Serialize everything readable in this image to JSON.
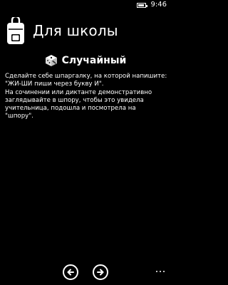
{
  "status": {
    "time": "9:46",
    "icons": [
      "battery-icon"
    ]
  },
  "header": {
    "title": "Для школы",
    "icon": "backpack-icon"
  },
  "section": {
    "icon": "dice-icon",
    "title": "Случайный"
  },
  "content": {
    "lines": [
      "Сделайте себе шпаргалку, на которой напишите:",
      "\"ЖИ-ШИ пиши через букву И\".",
      "На сочинении или диктанте демонстративно",
      "заглядывайте в шпору, чтобы это увидела",
      "учительница, подошла и посмотрела на",
      "\"шпору\"."
    ]
  },
  "app_bar": {
    "buttons": [
      {
        "icon": "arrow-left-icon"
      },
      {
        "icon": "arrow-right-icon"
      }
    ],
    "more_icon": "more-dots-icon"
  }
}
